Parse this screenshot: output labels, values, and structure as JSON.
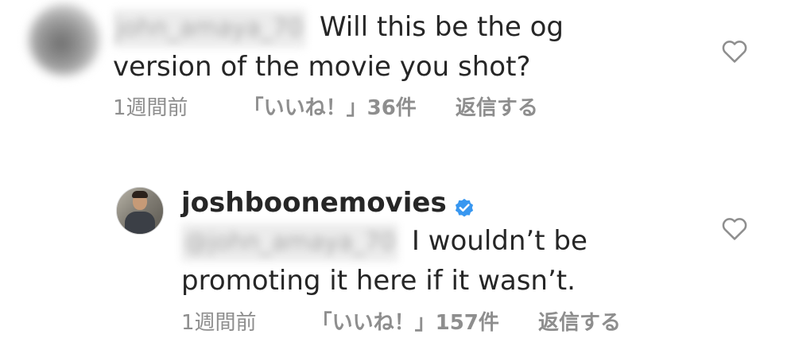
{
  "comments": [
    {
      "username": "john_amaya_70",
      "text": "Will this be the og version of the movie you shot?",
      "time": "1週間前",
      "likes": "「いいね！」36件",
      "reply_label": "返信する"
    },
    {
      "username": "joshboonemovies",
      "verified": true,
      "mention": "@john_amaya_70",
      "text": "I wouldn’t be promoting it here if it wasn’t.",
      "time": "1週間前",
      "likes": "「いいね！」157件",
      "reply_label": "返信する"
    }
  ],
  "icons": {
    "like": "heart-icon",
    "verified": "verified-badge-icon"
  },
  "colors": {
    "text": "#262626",
    "meta": "#8e8e8e",
    "verified": "#3897f0"
  }
}
